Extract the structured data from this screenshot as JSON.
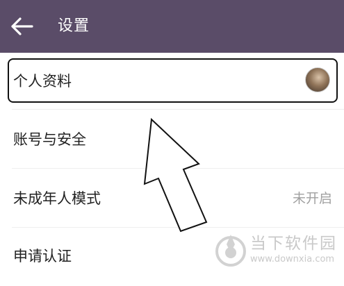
{
  "header": {
    "title": "设置",
    "back_icon": "arrow-left-icon",
    "background": "#5a4c68"
  },
  "settings": {
    "items": [
      {
        "label": "个人资料",
        "value": "",
        "icon": "avatar"
      },
      {
        "label": "账号与安全",
        "value": ""
      },
      {
        "label": "未成年人模式",
        "value": "未开启"
      },
      {
        "label": "申请认证",
        "value": ""
      }
    ]
  },
  "watermark": {
    "name": "当下软件园",
    "url": "www.downxia.com"
  }
}
